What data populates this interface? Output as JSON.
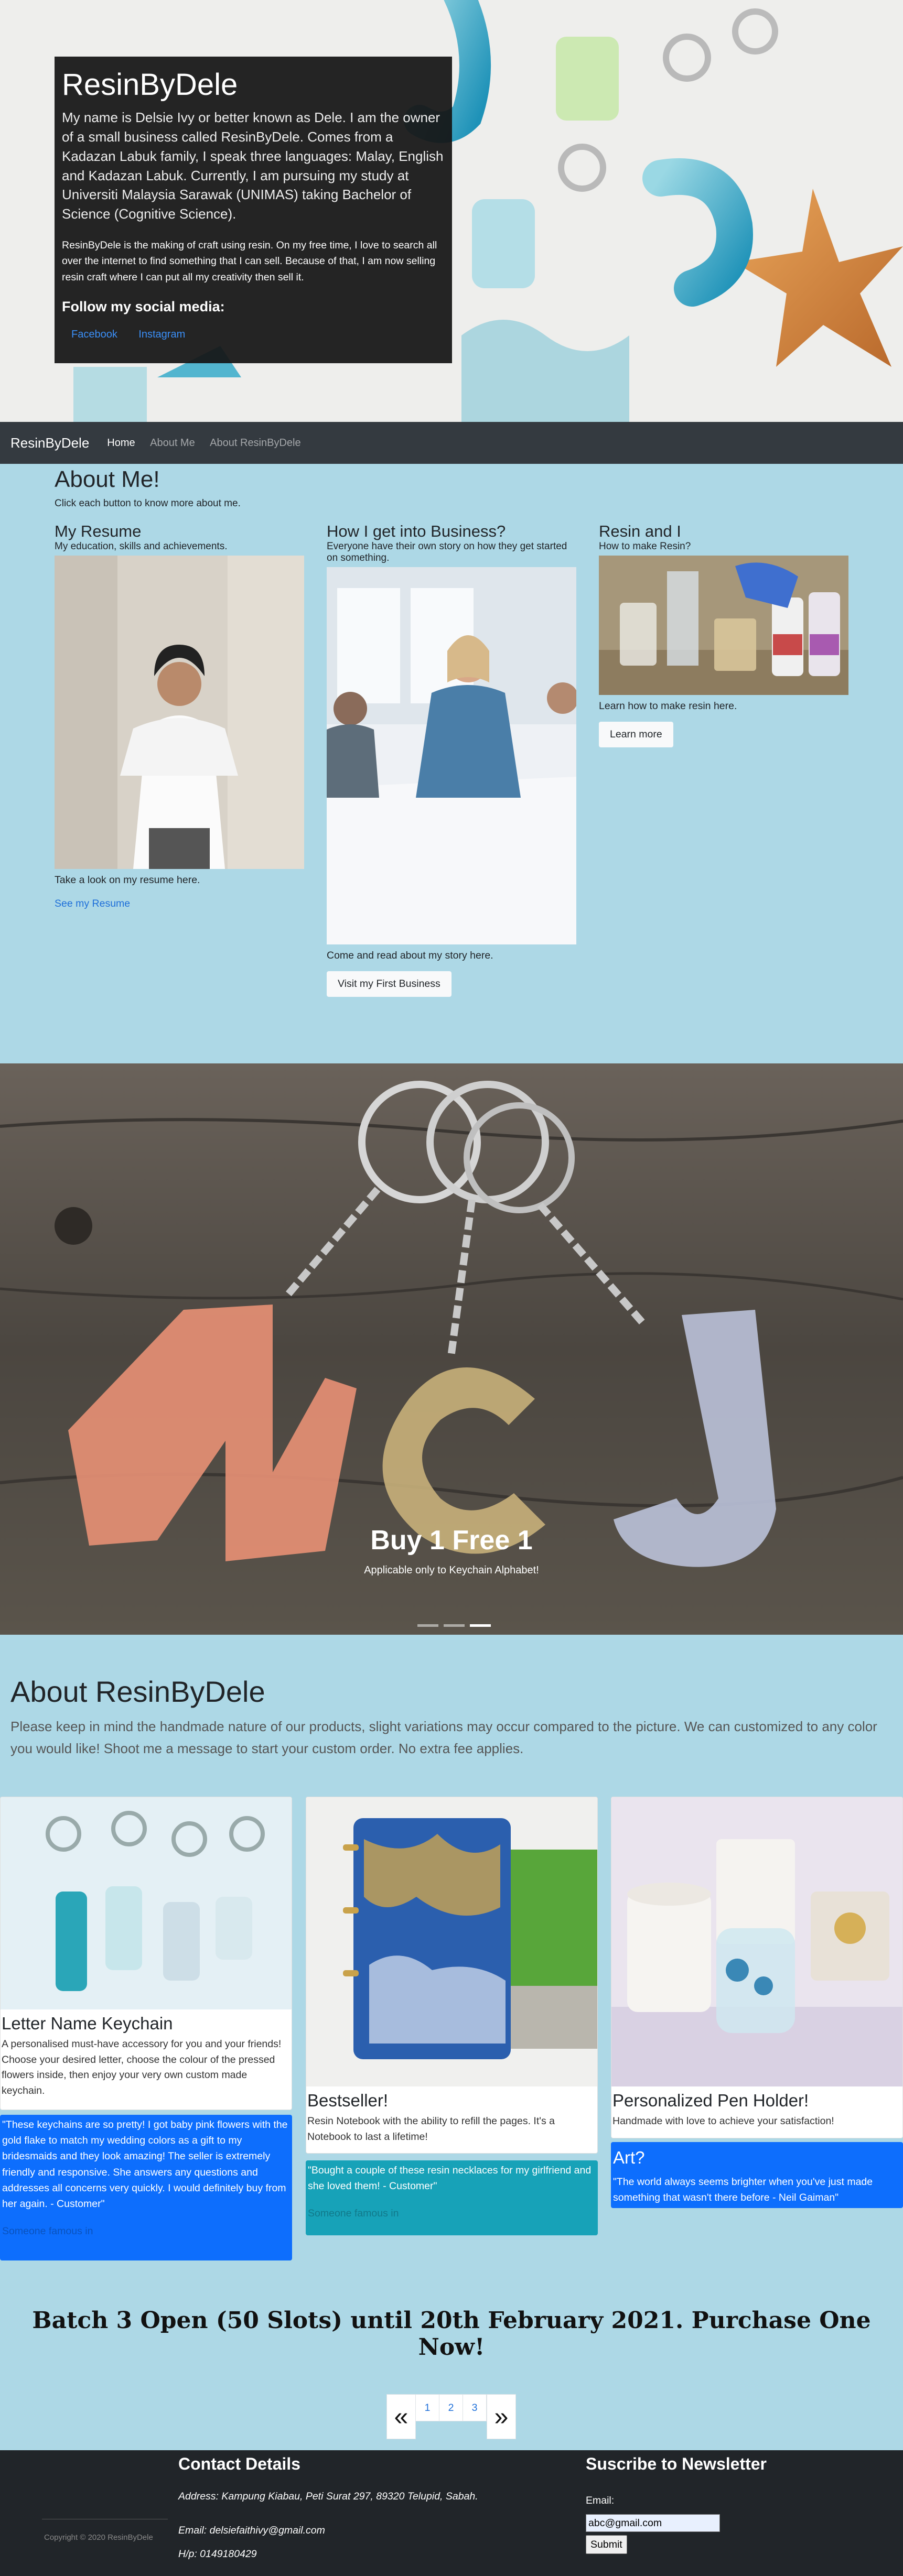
{
  "hero": {
    "title": "ResinByDele",
    "lead": "My name is Delsie Ivy or better known as Dele. I am the owner of a small business called ResinByDele. Comes from a Kadazan Labuk family, I speak three languages: Malay, English and Kadazan Labuk. Currently, I am pursuing my study at Universiti Malaysia Sarawak (UNIMAS) taking Bachelor of Science (Cognitive Science).",
    "body": "ResinByDele is the making of craft using resin. On my free time, I love to search all over the internet to find something that I can sell. Because of that, I am now selling resin craft where I can put all my creativity then sell it.",
    "social_heading": "Follow my social media:",
    "facebook": "Facebook",
    "instagram": "Instagram"
  },
  "navbar": {
    "brand": "ResinByDele",
    "items": [
      "Home",
      "About Me",
      "About ResinByDele"
    ]
  },
  "about_me": {
    "title": "About Me!",
    "subtitle": "Click each button to know more about me.",
    "columns": [
      {
        "title": "My Resume",
        "tagline": "My education, skills and achievements.",
        "caption": "Take a look on my resume here.",
        "action": "See my Resume"
      },
      {
        "title": "How I get into Business?",
        "tagline": "Everyone have their own story on how they get started on something.",
        "caption": "Come and read about my story here.",
        "action": "Visit my First Business"
      },
      {
        "title": "Resin and I",
        "tagline": "How to make Resin?",
        "caption": "Learn how to make resin here.",
        "action": "Learn more"
      }
    ]
  },
  "carousel": {
    "title": "Buy 1 Free 1",
    "subtitle": "Applicable only to Keychain Alphabet!"
  },
  "about_resin": {
    "title": "About ResinByDele",
    "lead": "Please keep in mind the handmade nature of our products, slight variations may occur compared to the picture. We can customized to any color you would like! Shoot me a message to start your custom order. No extra fee applies.",
    "cards": [
      {
        "title": "Letter Name Keychain",
        "text": "A personalised must-have accessory for you and your friends! Choose your desired letter, choose the colour of the pressed flowers inside, then enjoy your very own custom made keychain."
      },
      {
        "title": "Bestseller!",
        "text": "Resin Notebook with the ability to refill the pages. It's a Notebook to last a lifetime!"
      },
      {
        "title": "Personalized Pen Holder!",
        "text": "Handmade with love to achieve your satisfaction!"
      }
    ],
    "quotes": [
      {
        "text": "\"These keychains are so pretty! I got baby pink flowers with the gold flake to match my wedding colors as a gift to my bridesmaids and they look amazing! The seller is extremely friendly and responsive. She answers any questions and addresses all concerns very quickly. I would definitely buy from her again. - Customer\"",
        "footer": "Someone famous in"
      },
      {
        "text": "\"Bought a couple of these resin necklaces for my girlfriend and she loved them! - Customer\"",
        "footer": "Someone famous in"
      },
      {
        "title": "Art?",
        "text": "\"The world always seems brighter when you've just made something that wasn't there before - Neil Gaiman\""
      }
    ],
    "colors": {
      "primary": "#0d6efd",
      "info": "#17a2b8"
    }
  },
  "batch": "Batch 3 Open (50 Slots) until 20th February 2021. Purchase One Now!",
  "pagination": {
    "prev": "«",
    "next": "»",
    "pages": [
      "1",
      "2",
      "3"
    ]
  },
  "footer": {
    "copyright": "Copyright © 2020 ResinByDele",
    "contact": {
      "title": "Contact Details",
      "address": "Address: Kampung Kiabau, Peti Surat 297, 89320 Telupid, Sabah.",
      "email": "Email: delsiefaithivy@gmail.com",
      "phone": "H/p: 0149180429"
    },
    "newsletter": {
      "title": "Suscribe to Newsletter",
      "label": "Email:",
      "value": "abc@gmail.com",
      "submit": "Submit"
    }
  }
}
